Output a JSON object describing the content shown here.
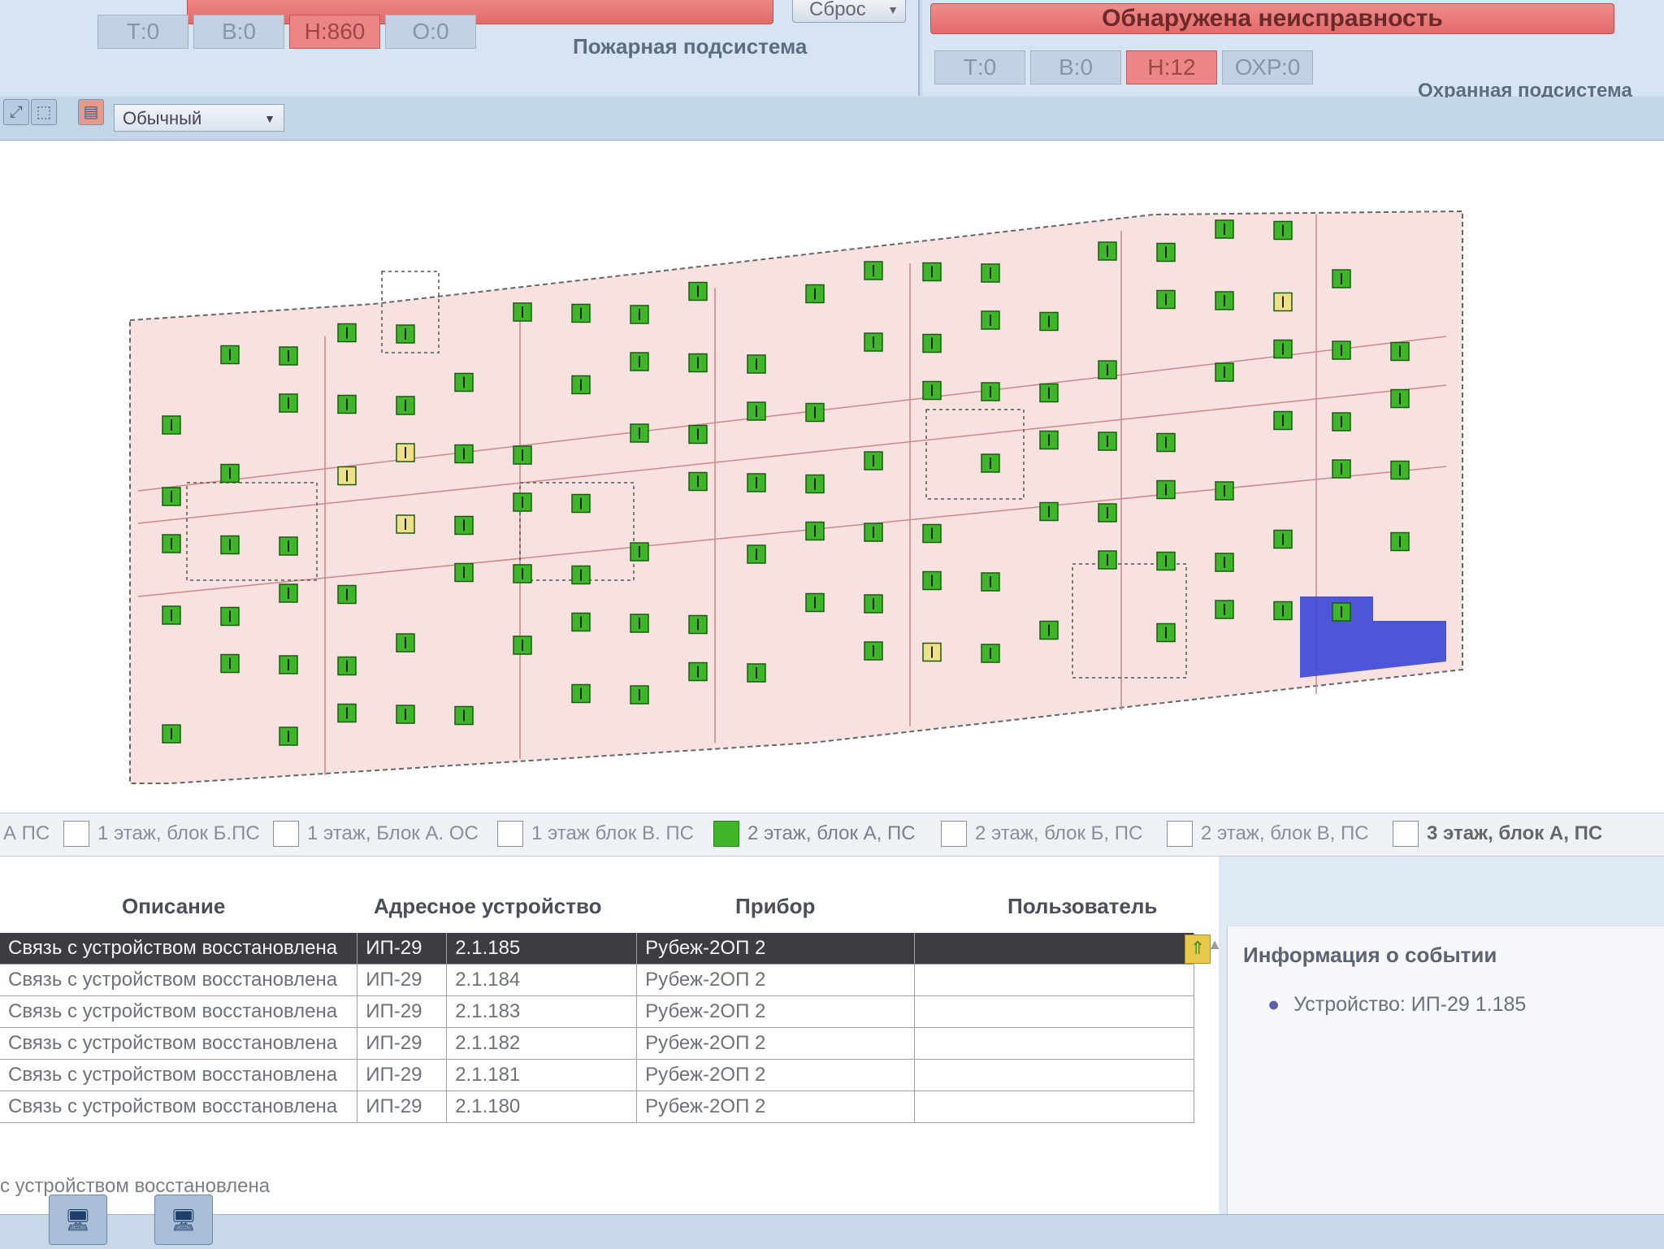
{
  "fire_subsystem": {
    "label": "Пожарная подсистема",
    "reset_label": "Сброс",
    "counters": [
      {
        "label": "Т:0",
        "alert": false
      },
      {
        "label": "В:0",
        "alert": false
      },
      {
        "label": "Н:860",
        "alert": true
      },
      {
        "label": "О:0",
        "alert": false
      }
    ]
  },
  "security_subsystem": {
    "label": "Охранная подсистема",
    "alarm_text": "Обнаружена неисправность",
    "counters": [
      {
        "label": "Т:0",
        "alert": false
      },
      {
        "label": "В:0",
        "alert": false
      },
      {
        "label": "Н:12",
        "alert": true
      },
      {
        "label": "ОХР:0",
        "alert": false
      }
    ]
  },
  "toolbar": {
    "mode_value": "Обычный"
  },
  "floor_tabs": [
    {
      "label": "А ПС",
      "active": false
    },
    {
      "label": "1 этаж, блок Б.ПС",
      "active": false
    },
    {
      "label": "1 этаж, Блок А. ОС",
      "active": false
    },
    {
      "label": "1 этаж блок В. ПС",
      "active": false
    },
    {
      "label": "2 этаж, блок А, ПС",
      "active": true
    },
    {
      "label": "2 этаж, блок Б, ПС",
      "active": false
    },
    {
      "label": "2 этаж, блок В, ПС",
      "active": false
    },
    {
      "label": "3 этаж, блок А, ПС",
      "active": false
    }
  ],
  "event_log": {
    "columns": {
      "description": "Описание",
      "address_device": "Адресное устройство",
      "device": "Прибор",
      "user": "Пользователь"
    },
    "rows": [
      {
        "description": "Связь с устройством восстановлена",
        "type": "ИП-29",
        "address": "2.1.185",
        "device": "Рубеж-2ОП 2",
        "user": "",
        "selected": true
      },
      {
        "description": "Связь с устройством восстановлена",
        "type": "ИП-29",
        "address": "2.1.184",
        "device": "Рубеж-2ОП 2",
        "user": "",
        "selected": false
      },
      {
        "description": "Связь с устройством восстановлена",
        "type": "ИП-29",
        "address": "2.1.183",
        "device": "Рубеж-2ОП 2",
        "user": "",
        "selected": false
      },
      {
        "description": "Связь с устройством восстановлена",
        "type": "ИП-29",
        "address": "2.1.182",
        "device": "Рубеж-2ОП 2",
        "user": "",
        "selected": false
      },
      {
        "description": "Связь с устройством восстановлена",
        "type": "ИП-29",
        "address": "2.1.181",
        "device": "Рубеж-2ОП 2",
        "user": "",
        "selected": false
      },
      {
        "description": "Связь с устройством восстановлена",
        "type": "ИП-29",
        "address": "2.1.180",
        "device": "Рубеж-2ОП 2",
        "user": "",
        "selected": false
      }
    ],
    "status_line": "с устройством восстановлена"
  },
  "event_info": {
    "title": "Информация о событии",
    "item": "Устройство: ИП-29 1.185"
  },
  "colors": {
    "detector_ok": "#3fb52a",
    "detector_warn": "#efe08a",
    "alarm_red": "#e26a6a",
    "zone_selected": "#3a46d8",
    "plan_fill": "#f8e1e1"
  }
}
